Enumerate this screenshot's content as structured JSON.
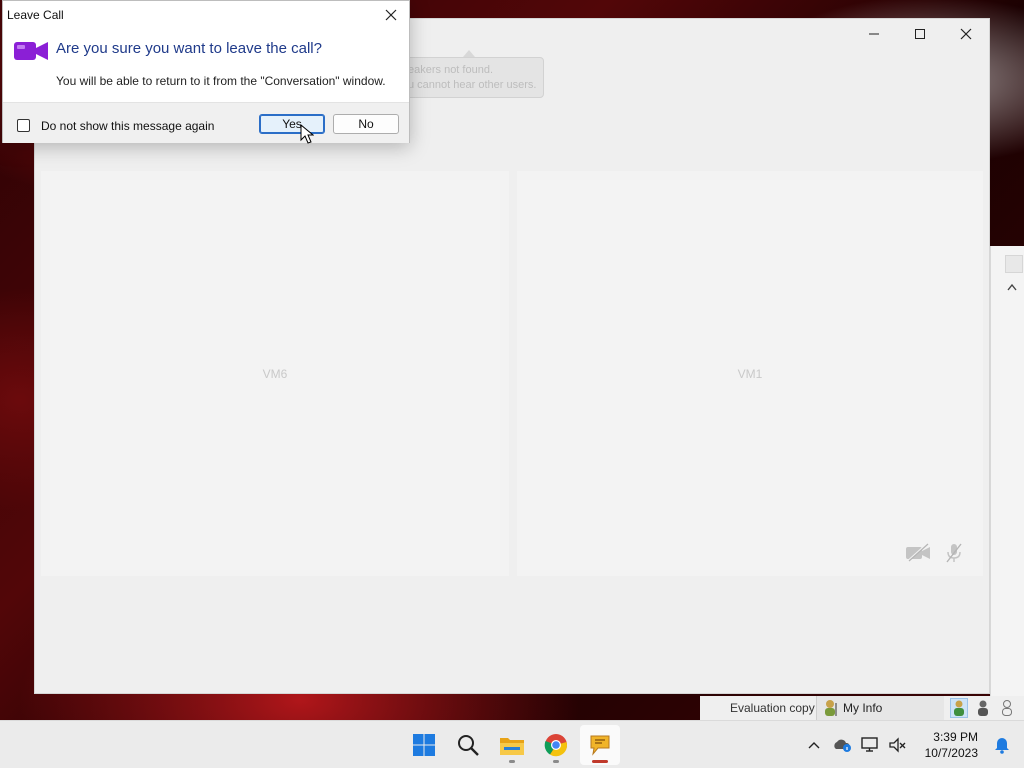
{
  "dialog": {
    "title": "Leave Call",
    "question": "Are you sure you want to leave the call?",
    "message": "You will be able to return to it from the \"Conversation\" window.",
    "checkbox_label": "Do not show this message again",
    "checkbox_checked": false,
    "yes_label": "Yes",
    "no_label": "No",
    "icon": "video-camera-icon"
  },
  "call_window": {
    "tooltip_lines": [
      "eakers not found.",
      "u cannot hear other users."
    ],
    "tiles": [
      {
        "name": "VM6"
      },
      {
        "name": "VM1"
      }
    ],
    "tile_icons": [
      "camera-off-icon",
      "mic-off-icon"
    ]
  },
  "status_bar": {
    "evaluation_text": "Evaluation copy",
    "my_info_label": "My Info"
  },
  "taskbar": {
    "apps": [
      "start-icon",
      "search-icon",
      "file-explorer-icon",
      "chrome-icon",
      "messenger-icon"
    ],
    "time": "3:39 PM",
    "date": "10/7/2023"
  },
  "colors": {
    "accent": "#2b6ec7",
    "question_text": "#1f3a8a",
    "camera_icon": "#8b1fd6"
  }
}
